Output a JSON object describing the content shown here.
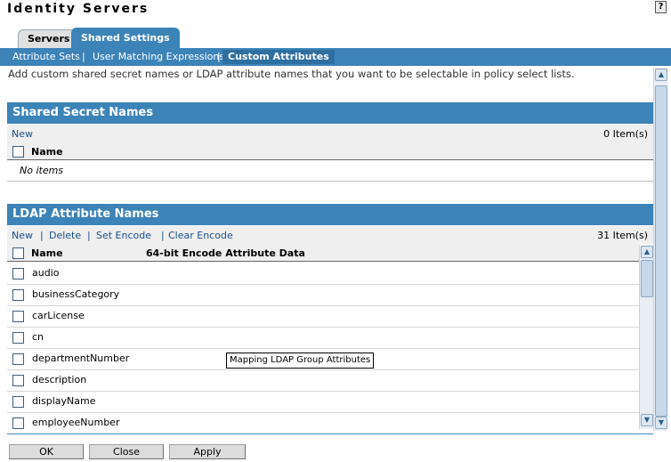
{
  "page": {
    "title": "Identity Servers",
    "help_label": "?"
  },
  "tabs": [
    {
      "label": "Servers"
    },
    {
      "label": "Shared Settings"
    }
  ],
  "subnav": [
    {
      "label": "Attribute Sets"
    },
    {
      "label": "User Matching Expressions"
    },
    {
      "label": "Custom Attributes"
    }
  ],
  "subnav_separator": "|",
  "intro_text": "Add custom shared secret names or LDAP attribute names that you want to be selectable in policy select lists.",
  "shared_secret": {
    "header": "Shared Secret Names",
    "new_label": "New",
    "count": "0 Item(s)",
    "col_name": "Name",
    "empty_text": "No items"
  },
  "ldap": {
    "header": "LDAP Attribute Names",
    "actions": [
      {
        "label": "New"
      },
      {
        "label": "Delete"
      },
      {
        "label": "Set Encode"
      },
      {
        "label": "Clear Encode"
      }
    ],
    "count": "31 Item(s)",
    "col_name": "Name",
    "col_encode": "64-bit Encode Attribute Data",
    "rows": [
      {
        "name": "audio"
      },
      {
        "name": "businessCategory"
      },
      {
        "name": "carLicense"
      },
      {
        "name": "cn"
      },
      {
        "name": "departmentNumber"
      },
      {
        "name": "description"
      },
      {
        "name": "displayName"
      },
      {
        "name": "employeeNumber"
      }
    ]
  },
  "tooltip": "Mapping LDAP Group Attributes",
  "buttons": {
    "ok": "OK",
    "close": "Close",
    "apply": "Apply"
  },
  "colors": {
    "accent": "#3c83b8",
    "link": "#1a4f86"
  }
}
